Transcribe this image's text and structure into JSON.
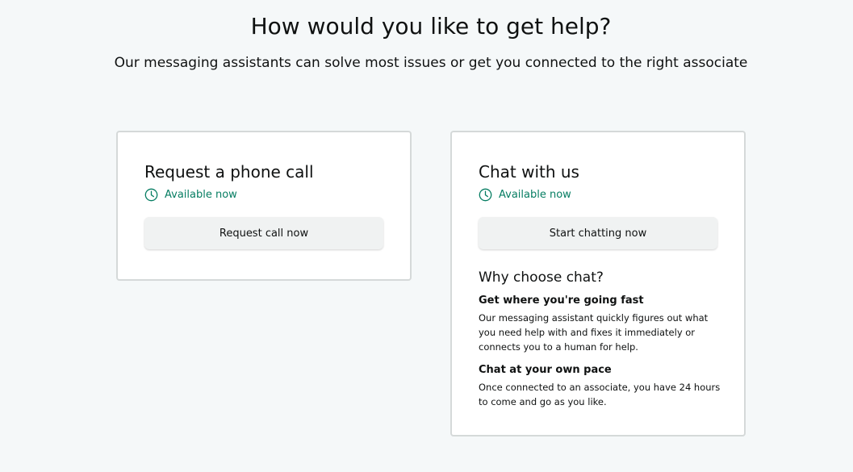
{
  "header": {
    "title": "How would you like to get help?",
    "subtitle": "Our messaging assistants can solve most issues or get you connected to the right associate"
  },
  "phone_card": {
    "title": "Request a phone call",
    "availability": "Available now",
    "button_label": "Request call now"
  },
  "chat_card": {
    "title": "Chat with us",
    "availability": "Available now",
    "button_label": "Start chatting now",
    "why_title": "Why choose chat?",
    "features": [
      {
        "heading": "Get where you're going fast",
        "text": "Our messaging assistant quickly figures out what you need help with and fixes it immediately or connects you to a human for help."
      },
      {
        "heading": "Chat at your own pace",
        "text": "Once connected to an associate, you have 24 hours to come and go as you like."
      }
    ]
  },
  "colors": {
    "background": "#f5f8f9",
    "available_green": "#067d62",
    "card_border": "#d5d9d9",
    "button_bg": "#f0f2f2"
  },
  "icons": {
    "availability": "clock-icon"
  }
}
